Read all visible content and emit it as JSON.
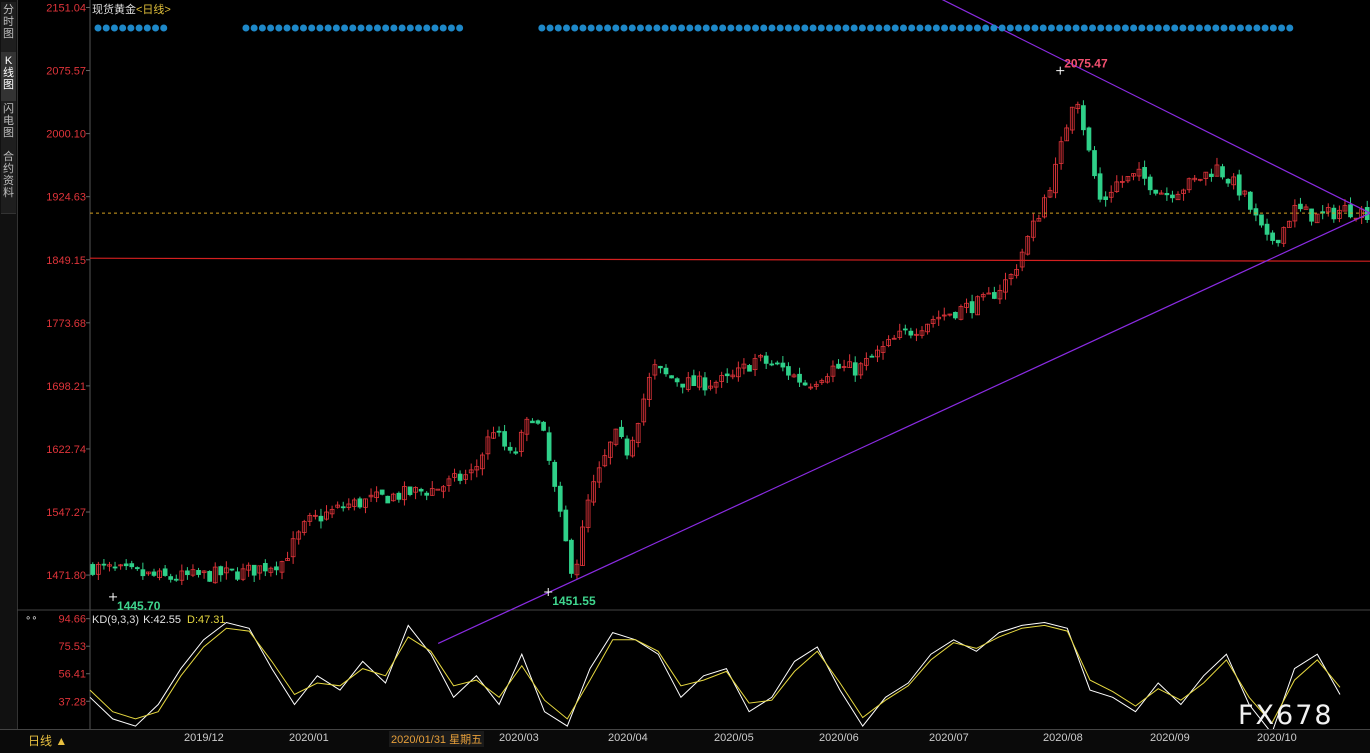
{
  "sidebar": {
    "tabs": [
      {
        "label": "分时图"
      },
      {
        "label": "K线图"
      },
      {
        "label": "闪电图"
      },
      {
        "label": "合约资料"
      }
    ]
  },
  "chart_title": {
    "name": "现货黄金",
    "period": "<日线>"
  },
  "kd": {
    "label": "KD(9,3,3)",
    "k": "K:42.55",
    "d": "D:47.31"
  },
  "kd_marker": "∘∘",
  "bottom": {
    "period_tab": "日线 ▲",
    "cursor_date": "2020/01/31 星期五",
    "x_labels": [
      "2019/12",
      "2020/01",
      "2020/03",
      "2020/04",
      "2020/05",
      "2020/06",
      "2020/07",
      "2020/08",
      "2020/09",
      "2020/10"
    ]
  },
  "watermark": "FX678",
  "colors": {
    "up": "#e0343a",
    "down": "#2fd089",
    "trendline": "#8a2be2",
    "support": "#d42020",
    "last_price": "#d4a020",
    "marker": "#1e88c8",
    "k_line": "#ffffff",
    "d_line": "#e6d840"
  },
  "chart_data": [
    {
      "type": "candlestick",
      "title": "现货黄金 <日线>",
      "ylim": [
        1430,
        2160
      ],
      "y_ticks": [
        "2151.04",
        "2075.57",
        "2000.10",
        "1924.63",
        "1849.15",
        "1773.68",
        "1698.21",
        "1622.74",
        "1547.27",
        "1471.80"
      ],
      "x_labels": [
        "2019/12",
        "2020/01",
        "2020/03",
        "2020/04",
        "2020/05",
        "2020/06",
        "2020/07",
        "2020/08",
        "2020/09",
        "2020/10"
      ],
      "annotations": [
        {
          "label": "2075.47",
          "value": 2075.47,
          "kind": "high"
        },
        {
          "label": "1445.70",
          "value": 1445.7,
          "kind": "low"
        },
        {
          "label": "1451.55",
          "value": 1451.55,
          "kind": "low"
        }
      ],
      "support_level": 1851,
      "last_price": 1905,
      "trendlines": [
        {
          "from": [
            0.272,
            1390
          ],
          "to": [
            1.0,
            1905
          ]
        },
        {
          "from": [
            0.66,
            2165
          ],
          "to": [
            1.0,
            1905
          ]
        }
      ],
      "close_path": [
        [
          0,
          1482
        ],
        [
          0.06,
          1468
        ],
        [
          0.12,
          1475
        ],
        [
          0.15,
          1488
        ],
        [
          0.17,
          1535
        ],
        [
          0.2,
          1555
        ],
        [
          0.23,
          1565
        ],
        [
          0.27,
          1575
        ],
        [
          0.3,
          1595
        ],
        [
          0.315,
          1648
        ],
        [
          0.33,
          1610
        ],
        [
          0.345,
          1665
        ],
        [
          0.355,
          1635
        ],
        [
          0.37,
          1520
        ],
        [
          0.378,
          1470
        ],
        [
          0.39,
          1565
        ],
        [
          0.41,
          1640
        ],
        [
          0.42,
          1620
        ],
        [
          0.44,
          1720
        ],
        [
          0.45,
          1710
        ],
        [
          0.47,
          1700
        ],
        [
          0.5,
          1705
        ],
        [
          0.52,
          1730
        ],
        [
          0.54,
          1720
        ],
        [
          0.56,
          1700
        ],
        [
          0.58,
          1720
        ],
        [
          0.6,
          1718
        ],
        [
          0.63,
          1755
        ],
        [
          0.66,
          1780
        ],
        [
          0.7,
          1800
        ],
        [
          0.72,
          1830
        ],
        [
          0.74,
          1900
        ],
        [
          0.755,
          1960
        ],
        [
          0.77,
          2055
        ],
        [
          0.78,
          1980
        ],
        [
          0.79,
          1915
        ],
        [
          0.8,
          1940
        ],
        [
          0.82,
          1950
        ],
        [
          0.84,
          1928
        ],
        [
          0.86,
          1940
        ],
        [
          0.88,
          1960
        ],
        [
          0.9,
          1930
        ],
        [
          0.92,
          1870
        ],
        [
          0.93,
          1880
        ],
        [
          0.94,
          1910
        ],
        [
          0.96,
          1900
        ],
        [
          0.98,
          1910
        ],
        [
          1.0,
          1905
        ]
      ],
      "marker_dot_count": 146
    },
    {
      "type": "line",
      "title": "KD(9,3,3)",
      "ylim": [
        18,
        100
      ],
      "y_ticks": [
        "94.66",
        "75.53",
        "56.41",
        "37.28"
      ],
      "series": [
        {
          "name": "K",
          "values": [
            40,
            25,
            20,
            35,
            60,
            80,
            92,
            88,
            60,
            35,
            55,
            45,
            65,
            50,
            90,
            70,
            40,
            55,
            35,
            70,
            30,
            20,
            60,
            85,
            80,
            70,
            40,
            55,
            60,
            30,
            40,
            65,
            75,
            45,
            20,
            40,
            50,
            70,
            80,
            72,
            85,
            90,
            92,
            88,
            45,
            40,
            30,
            50,
            35,
            55,
            70,
            35,
            15,
            60,
            70,
            42
          ]
        },
        {
          "name": "D",
          "values": [
            45,
            30,
            25,
            30,
            55,
            75,
            88,
            86,
            65,
            42,
            50,
            48,
            60,
            55,
            82,
            72,
            48,
            52,
            40,
            62,
            38,
            25,
            52,
            80,
            80,
            72,
            48,
            52,
            58,
            36,
            38,
            58,
            72,
            50,
            26,
            38,
            48,
            66,
            78,
            74,
            82,
            88,
            90,
            86,
            52,
            44,
            34,
            46,
            38,
            50,
            66,
            40,
            22,
            52,
            66,
            47
          ]
        }
      ]
    }
  ]
}
